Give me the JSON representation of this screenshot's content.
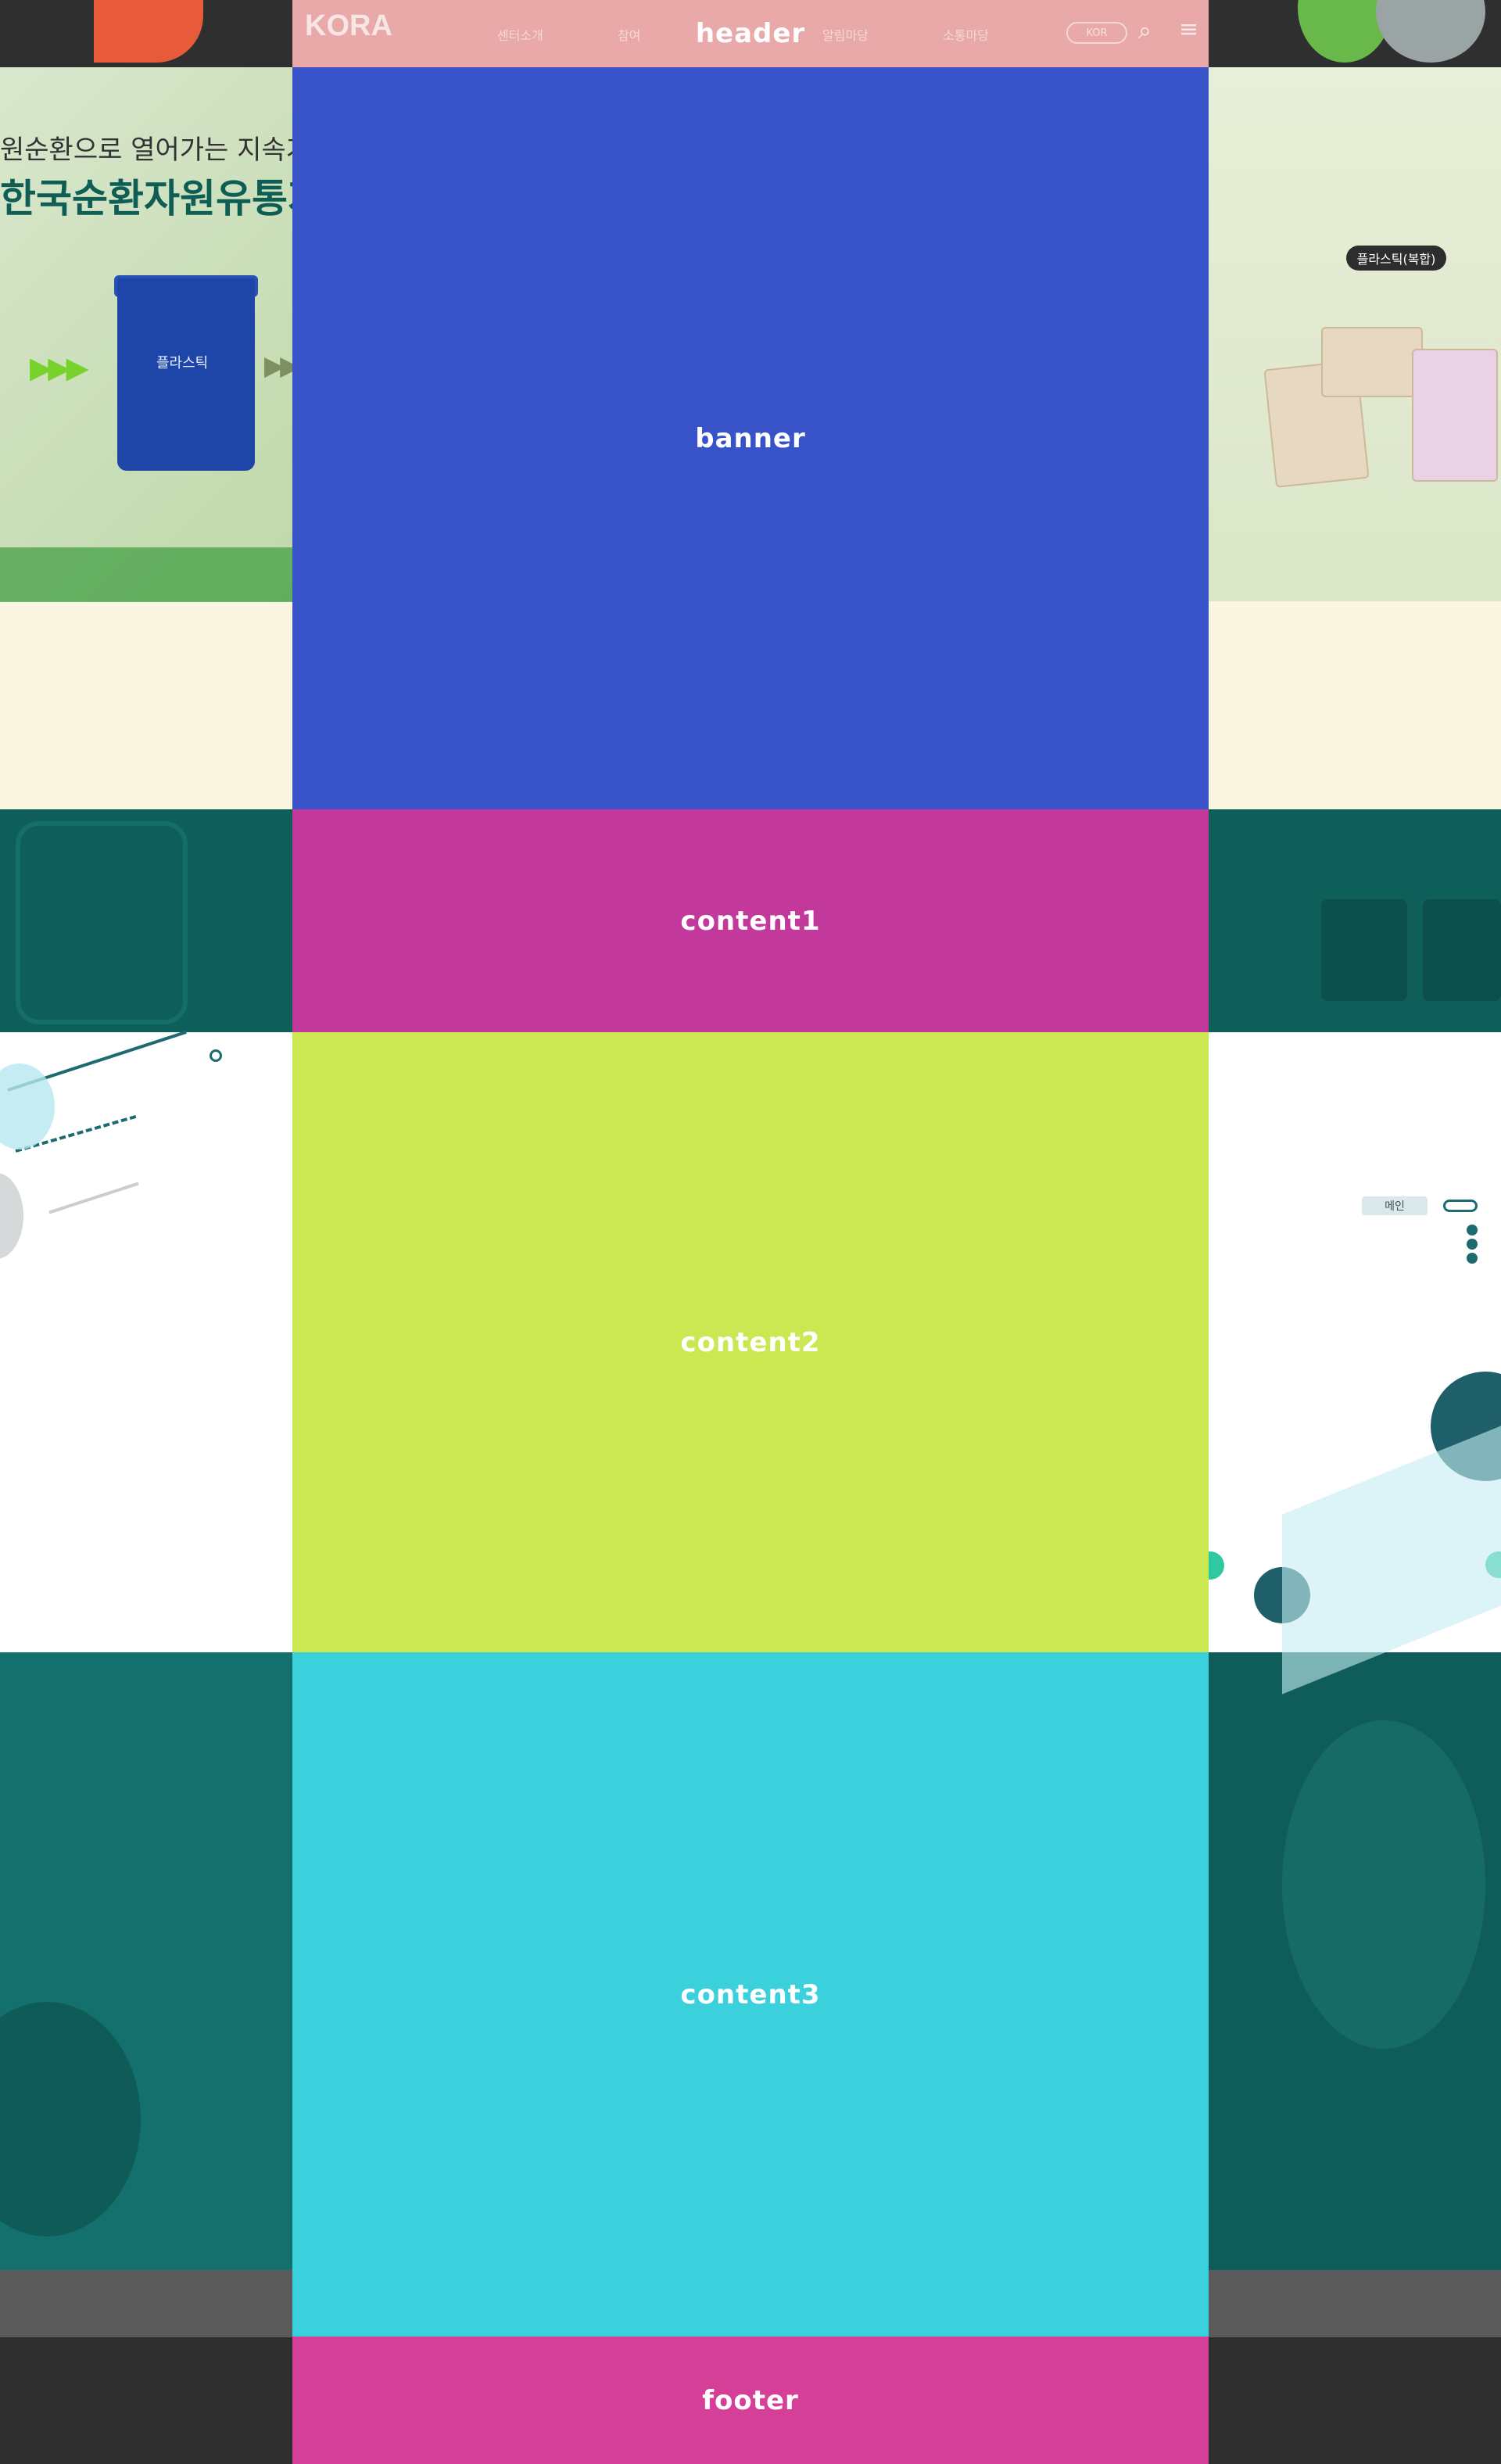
{
  "sections": {
    "header": "header",
    "banner": "banner",
    "content1": "content1",
    "content2": "content2",
    "content3": "content3",
    "footer": "footer"
  },
  "header": {
    "logo_text": "KORA",
    "nav": [
      "센터소개",
      "참여",
      "알림마당",
      "소통마당"
    ],
    "language_label": "KOR",
    "icons": [
      "search-icon",
      "menu-icon"
    ]
  },
  "hero": {
    "subtitle": "원순환으로 열어가는 지속가능한 미래",
    "title": "한국순환자원유통지원센터",
    "bin_label": "플라스틱",
    "right_tag": "플라스틱(복합)"
  },
  "side": {
    "main_button": "메인"
  },
  "colors": {
    "header": "#e8a9a8",
    "banner": "#3853c8",
    "content1": "#c2389b",
    "content2": "#cbe852",
    "content3": "#3ad1dd",
    "footer": "#d53f97",
    "teal": "#0e5e5a"
  }
}
